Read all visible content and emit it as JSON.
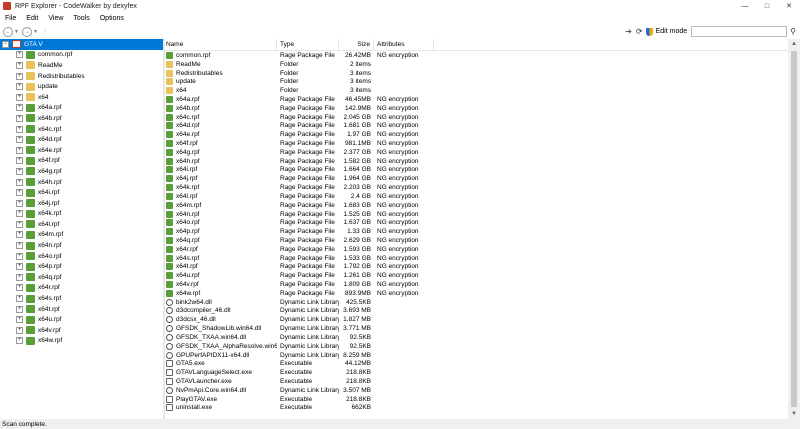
{
  "window": {
    "title": "RPF Explorer - CodeWalker by dexyfex"
  },
  "menu": [
    "File",
    "Edit",
    "View",
    "Tools",
    "Options"
  ],
  "toolbar": {
    "edit_mode_label": "Edit mode",
    "search_value": ""
  },
  "tree": {
    "root": "GTA V",
    "children": [
      "common.rpf",
      "ReadMe",
      "Redistributables",
      "update",
      "x64",
      "x64a.rpf",
      "x64b.rpf",
      "x64c.rpf",
      "x64d.rpf",
      "x64e.rpf",
      "x64f.rpf",
      "x64g.rpf",
      "x64h.rpf",
      "x64i.rpf",
      "x64j.rpf",
      "x64k.rpf",
      "x64l.rpf",
      "x64m.rpf",
      "x64n.rpf",
      "x64o.rpf",
      "x64p.rpf",
      "x64q.rpf",
      "x64r.rpf",
      "x64s.rpf",
      "x64t.rpf",
      "x64u.rpf",
      "x64v.rpf",
      "x64w.rpf"
    ],
    "child_types": [
      "rpf",
      "folder",
      "folder",
      "folder",
      "folder",
      "rpf",
      "rpf",
      "rpf",
      "rpf",
      "rpf",
      "rpf",
      "rpf",
      "rpf",
      "rpf",
      "rpf",
      "rpf",
      "rpf",
      "rpf",
      "rpf",
      "rpf",
      "rpf",
      "rpf",
      "rpf",
      "rpf",
      "rpf",
      "rpf",
      "rpf",
      "rpf"
    ]
  },
  "list": {
    "columns": {
      "name": "Name",
      "type": "Type",
      "size": "Size",
      "attributes": "Attributes"
    },
    "rows": [
      {
        "icon": "rpf",
        "name": "common.rpf",
        "type": "Rage Package File",
        "size": "26.42MB",
        "attr": "NG encryption"
      },
      {
        "icon": "folder",
        "name": "ReadMe",
        "type": "Folder",
        "size": "2 items",
        "attr": ""
      },
      {
        "icon": "folder",
        "name": "Redistributables",
        "type": "Folder",
        "size": "3 items",
        "attr": ""
      },
      {
        "icon": "folder",
        "name": "update",
        "type": "Folder",
        "size": "3 items",
        "attr": ""
      },
      {
        "icon": "folder",
        "name": "x64",
        "type": "Folder",
        "size": "3 items",
        "attr": ""
      },
      {
        "icon": "rpf",
        "name": "x64a.rpf",
        "type": "Rage Package File",
        "size": "46.45MB",
        "attr": "NG encryption"
      },
      {
        "icon": "rpf",
        "name": "x64b.rpf",
        "type": "Rage Package File",
        "size": "142.9MB",
        "attr": "NG encryption"
      },
      {
        "icon": "rpf",
        "name": "x64c.rpf",
        "type": "Rage Package File",
        "size": "2.045 GB",
        "attr": "NG encryption"
      },
      {
        "icon": "rpf",
        "name": "x64d.rpf",
        "type": "Rage Package File",
        "size": "1.681 GB",
        "attr": "NG encryption"
      },
      {
        "icon": "rpf",
        "name": "x64e.rpf",
        "type": "Rage Package File",
        "size": "1.97 GB",
        "attr": "NG encryption"
      },
      {
        "icon": "rpf",
        "name": "x64f.rpf",
        "type": "Rage Package File",
        "size": "981.1MB",
        "attr": "NG encryption"
      },
      {
        "icon": "rpf",
        "name": "x64g.rpf",
        "type": "Rage Package File",
        "size": "2.377 GB",
        "attr": "NG encryption"
      },
      {
        "icon": "rpf",
        "name": "x64h.rpf",
        "type": "Rage Package File",
        "size": "1.582 GB",
        "attr": "NG encryption"
      },
      {
        "icon": "rpf",
        "name": "x64i.rpf",
        "type": "Rage Package File",
        "size": "1.664 GB",
        "attr": "NG encryption"
      },
      {
        "icon": "rpf",
        "name": "x64j.rpf",
        "type": "Rage Package File",
        "size": "1.964 GB",
        "attr": "NG encryption"
      },
      {
        "icon": "rpf",
        "name": "x64k.rpf",
        "type": "Rage Package File",
        "size": "2.203 GB",
        "attr": "NG encryption"
      },
      {
        "icon": "rpf",
        "name": "x64l.rpf",
        "type": "Rage Package File",
        "size": "2.4 GB",
        "attr": "NG encryption"
      },
      {
        "icon": "rpf",
        "name": "x64m.rpf",
        "type": "Rage Package File",
        "size": "1.683 GB",
        "attr": "NG encryption"
      },
      {
        "icon": "rpf",
        "name": "x64n.rpf",
        "type": "Rage Package File",
        "size": "1.525 GB",
        "attr": "NG encryption"
      },
      {
        "icon": "rpf",
        "name": "x64o.rpf",
        "type": "Rage Package File",
        "size": "1.637 GB",
        "attr": "NG encryption"
      },
      {
        "icon": "rpf",
        "name": "x64p.rpf",
        "type": "Rage Package File",
        "size": "1.33 GB",
        "attr": "NG encryption"
      },
      {
        "icon": "rpf",
        "name": "x64q.rpf",
        "type": "Rage Package File",
        "size": "2.629 GB",
        "attr": "NG encryption"
      },
      {
        "icon": "rpf",
        "name": "x64r.rpf",
        "type": "Rage Package File",
        "size": "1.593 GB",
        "attr": "NG encryption"
      },
      {
        "icon": "rpf",
        "name": "x64s.rpf",
        "type": "Rage Package File",
        "size": "1.533 GB",
        "attr": "NG encryption"
      },
      {
        "icon": "rpf",
        "name": "x64t.rpf",
        "type": "Rage Package File",
        "size": "1.792 GB",
        "attr": "NG encryption"
      },
      {
        "icon": "rpf",
        "name": "x64u.rpf",
        "type": "Rage Package File",
        "size": "1.261 GB",
        "attr": "NG encryption"
      },
      {
        "icon": "rpf",
        "name": "x64v.rpf",
        "type": "Rage Package File",
        "size": "1.809 GB",
        "attr": "NG encryption"
      },
      {
        "icon": "rpf",
        "name": "x64w.rpf",
        "type": "Rage Package File",
        "size": "893.9MB",
        "attr": "NG encryption"
      },
      {
        "icon": "dll",
        "name": "bink2w64.dll",
        "type": "Dynamic Link Library",
        "size": "425.5KB",
        "attr": ""
      },
      {
        "icon": "dll",
        "name": "d3dcompiler_46.dll",
        "type": "Dynamic Link Library",
        "size": "3.693 MB",
        "attr": ""
      },
      {
        "icon": "dll",
        "name": "d3dcsx_46.dll",
        "type": "Dynamic Link Library",
        "size": "1.827 MB",
        "attr": ""
      },
      {
        "icon": "dll",
        "name": "GFSDK_ShadowLib.win64.dll",
        "type": "Dynamic Link Library",
        "size": "3.771 MB",
        "attr": ""
      },
      {
        "icon": "dll",
        "name": "GFSDK_TXAA.win64.dll",
        "type": "Dynamic Link Library",
        "size": "92.5KB",
        "attr": ""
      },
      {
        "icon": "dll",
        "name": "GFSDK_TXAA_AlphaResolve.win64.dll",
        "type": "Dynamic Link Library",
        "size": "92.5KB",
        "attr": ""
      },
      {
        "icon": "dll",
        "name": "GPUPerfAPIDX11-x64.dll",
        "type": "Dynamic Link Library",
        "size": "8.259 MB",
        "attr": ""
      },
      {
        "icon": "exe",
        "name": "GTA5.exe",
        "type": "Executable",
        "size": "44.12MB",
        "attr": ""
      },
      {
        "icon": "exe",
        "name": "GTAVLanguageSelect.exe",
        "type": "Executable",
        "size": "218.8KB",
        "attr": ""
      },
      {
        "icon": "exe",
        "name": "GTAVLauncher.exe",
        "type": "Executable",
        "size": "218.8KB",
        "attr": ""
      },
      {
        "icon": "dll",
        "name": "NvPmApi.Core.win64.dll",
        "type": "Dynamic Link Library",
        "size": "3.507 MB",
        "attr": ""
      },
      {
        "icon": "exe",
        "name": "PlayGTAV.exe",
        "type": "Executable",
        "size": "218.8KB",
        "attr": ""
      },
      {
        "icon": "exe",
        "name": "uninstall.exe",
        "type": "Executable",
        "size": "662KB",
        "attr": ""
      }
    ]
  },
  "status": {
    "text": "Scan complete."
  }
}
